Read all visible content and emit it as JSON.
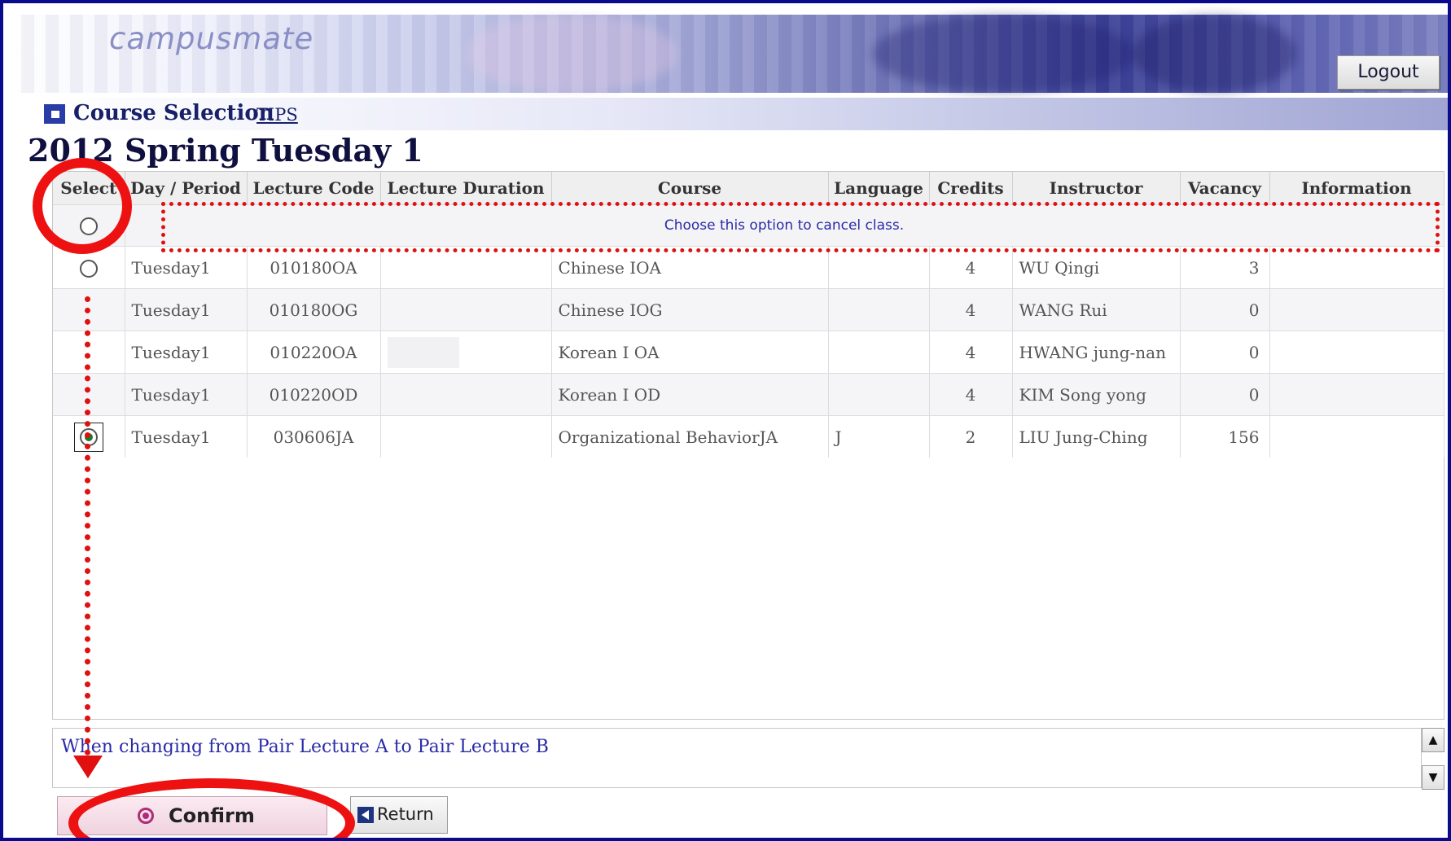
{
  "header": {
    "logo_text": "campusmate",
    "logout_label": "Logout"
  },
  "titlebar": {
    "title": "Course Selection",
    "tips_link": "TIPS"
  },
  "page_title": "2012 Spring Tuesday 1",
  "table": {
    "columns": [
      "Select",
      "Day / Period",
      "Lecture Code",
      "Lecture Duration",
      "Course",
      "Language",
      "Credits",
      "Instructor",
      "Vacancy",
      "Information"
    ],
    "cancel_option_text": "Choose this option to cancel class.",
    "rows": [
      {
        "day_period": "Tuesday1",
        "code": "010180OA",
        "duration": "",
        "course": "Chinese IOA",
        "language": "",
        "credits": "4",
        "instructor": "WU Qingi",
        "vacancy": "3",
        "information": ""
      },
      {
        "day_period": "Tuesday1",
        "code": "010180OG",
        "duration": "",
        "course": "Chinese IOG",
        "language": "",
        "credits": "4",
        "instructor": "WANG Rui",
        "vacancy": "0",
        "information": ""
      },
      {
        "day_period": "Tuesday1",
        "code": "010220OA",
        "duration": "",
        "course": "Korean I OA",
        "language": "",
        "credits": "4",
        "instructor": "HWANG jung-nan",
        "vacancy": "0",
        "information": ""
      },
      {
        "day_period": "Tuesday1",
        "code": "010220OD",
        "duration": "",
        "course": "Korean I OD",
        "language": "",
        "credits": "4",
        "instructor": "KIM Song yong",
        "vacancy": "0",
        "information": ""
      },
      {
        "day_period": "Tuesday1",
        "code": "030606JA",
        "duration": "",
        "course": "Organizational BehaviorJA",
        "language": "J",
        "credits": "2",
        "instructor": "LIU Jung-Ching",
        "vacancy": "156",
        "information": "",
        "selected": true
      }
    ]
  },
  "note": {
    "text": "When changing from Pair Lecture A to Pair Lecture B"
  },
  "buttons": {
    "confirm_label": "Confirm",
    "return_label": "Return"
  },
  "colors": {
    "frame": "#0a0a8c",
    "annotation": "#ee1111",
    "link_text": "#2b2ba8"
  }
}
